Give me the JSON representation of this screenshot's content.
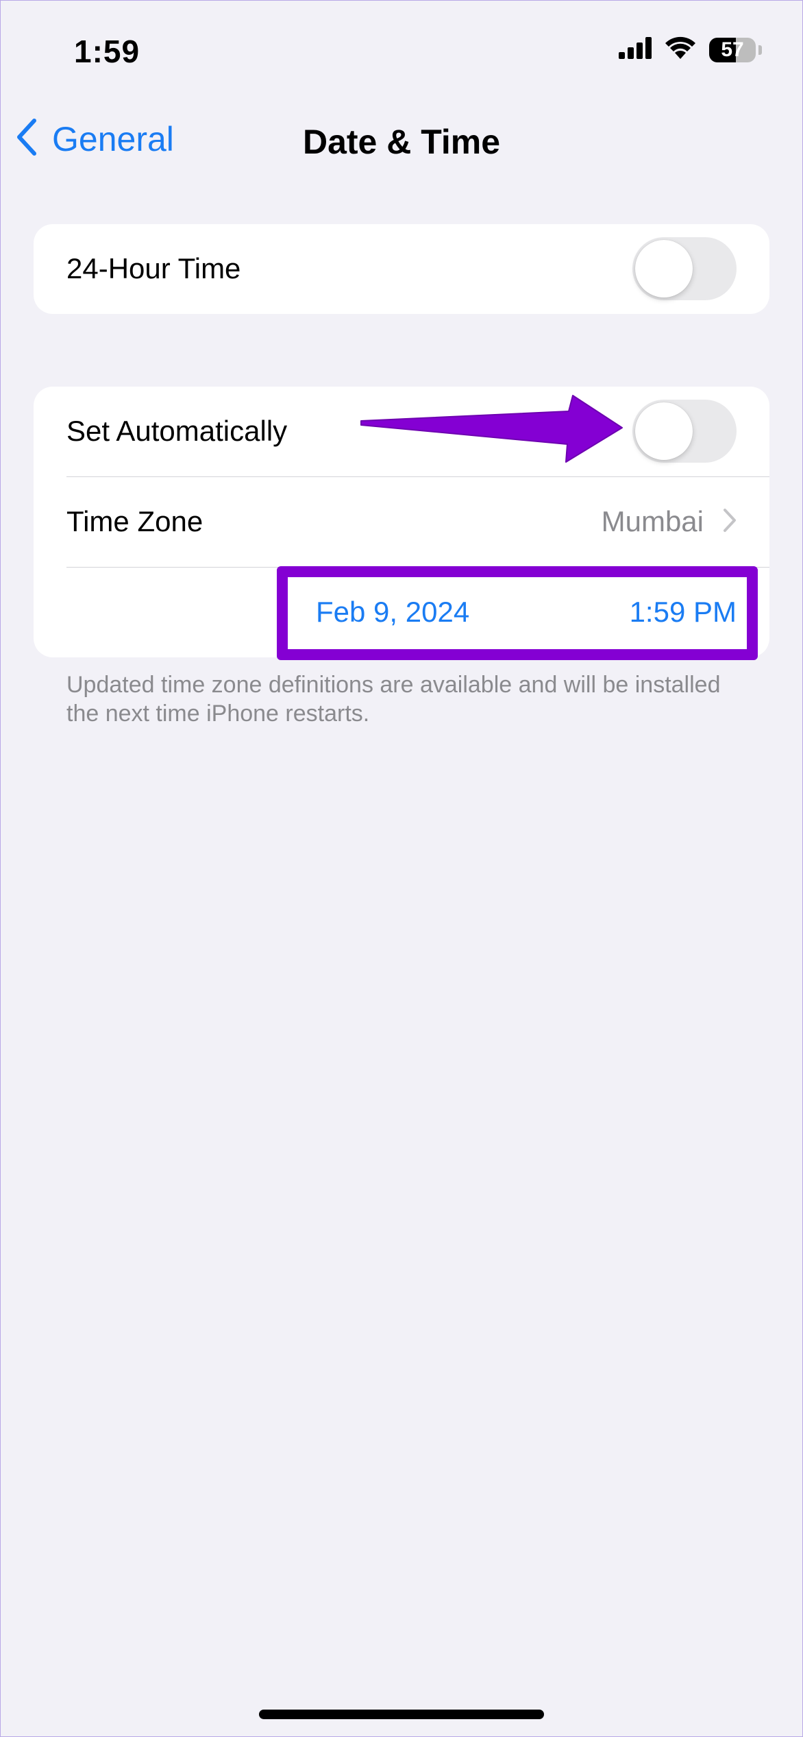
{
  "status_bar": {
    "time": "1:59",
    "battery": "57",
    "battery_level_percent": 57
  },
  "nav": {
    "back_label": "General",
    "title": "Date & Time"
  },
  "group1": {
    "rows": [
      {
        "label": "24-Hour Time",
        "toggle_on": false
      }
    ]
  },
  "group2": {
    "set_automatically": {
      "label": "Set Automatically",
      "toggle_on": false
    },
    "time_zone": {
      "label": "Time Zone",
      "value": "Mumbai"
    },
    "date_time": {
      "date": "Feb 9, 2024",
      "time": "1:59 PM"
    }
  },
  "footnote": "Updated time zone definitions are available and will be installed the next time iPhone restarts.",
  "colors": {
    "accent": "#1a7cf3",
    "annotation": "#8400d3",
    "background": "#f2f1f7"
  },
  "icons": {
    "back": "chevron-left-icon",
    "disclosure": "chevron-right-icon",
    "signal": "cellular-signal-icon",
    "wifi": "wifi-icon",
    "battery": "battery-icon"
  }
}
